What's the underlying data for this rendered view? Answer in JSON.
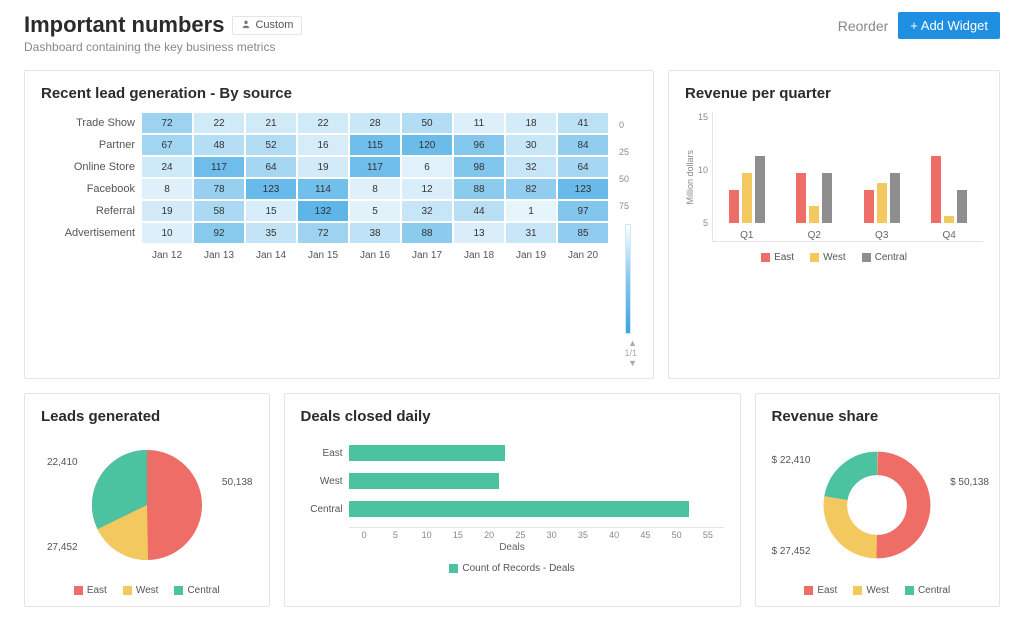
{
  "header": {
    "title": "Important numbers",
    "custom_label": "Custom",
    "subtitle": "Dashboard containing the key business metrics",
    "reorder_label": "Reorder",
    "add_widget_label": "+ Add Widget"
  },
  "heatmap": {
    "title": "Recent lead generation - By source",
    "row_labels": [
      "Trade Show",
      "Partner",
      "Online Store",
      "Facebook",
      "Referral",
      "Advertisement"
    ],
    "col_labels": [
      "Jan 12",
      "Jan 13",
      "Jan 14",
      "Jan 15",
      "Jan 16",
      "Jan 17",
      "Jan 18",
      "Jan 19",
      "Jan 20"
    ],
    "cells": [
      [
        72,
        22,
        21,
        22,
        28,
        50,
        11,
        18,
        41
      ],
      [
        67,
        48,
        52,
        16,
        115,
        120,
        96,
        30,
        84
      ],
      [
        24,
        117,
        64,
        19,
        117,
        6,
        98,
        32,
        64
      ],
      [
        8,
        78,
        123,
        114,
        8,
        12,
        88,
        82,
        123
      ],
      [
        19,
        58,
        15,
        132,
        5,
        32,
        44,
        1,
        97
      ],
      [
        10,
        92,
        35,
        72,
        38,
        88,
        13,
        31,
        85
      ]
    ],
    "scale": {
      "ticks": [
        "0",
        "25",
        "50",
        "75"
      ]
    },
    "pager": "1/1"
  },
  "revenue_quarter": {
    "title": "Revenue per quarter",
    "ylabel": "Million dollars",
    "yticks": [
      "15",
      "10",
      "5"
    ],
    "legend": [
      "East",
      "West",
      "Central"
    ]
  },
  "leads_generated": {
    "title": "Leads generated",
    "labels": {
      "east": "50,138",
      "west": "27,452",
      "teal": "22,410"
    },
    "legend": [
      "East",
      "West",
      "Central"
    ]
  },
  "deals_closed": {
    "title": "Deals closed daily",
    "row_labels": [
      "East",
      "West",
      "Central"
    ],
    "xlabel": "Deals",
    "legend_label": "Count of Records - Deals",
    "ticks": [
      "0",
      "5",
      "10",
      "15",
      "20",
      "25",
      "30",
      "35",
      "40",
      "45",
      "50",
      "55"
    ]
  },
  "revenue_share": {
    "title": "Revenue share",
    "labels": {
      "east": "$ 50,138",
      "west": "$ 27,452",
      "teal": "$ 22,410"
    },
    "legend": [
      "East",
      "West",
      "Central"
    ]
  },
  "chart_data": [
    {
      "type": "heatmap",
      "title": "Recent lead generation - By source",
      "x": [
        "Jan 12",
        "Jan 13",
        "Jan 14",
        "Jan 15",
        "Jan 16",
        "Jan 17",
        "Jan 18",
        "Jan 19",
        "Jan 20"
      ],
      "y": [
        "Trade Show",
        "Partner",
        "Online Store",
        "Facebook",
        "Referral",
        "Advertisement"
      ],
      "z": [
        [
          72,
          22,
          21,
          22,
          28,
          50,
          11,
          18,
          41
        ],
        [
          67,
          48,
          52,
          16,
          115,
          120,
          96,
          30,
          84
        ],
        [
          24,
          117,
          64,
          19,
          117,
          6,
          98,
          32,
          64
        ],
        [
          8,
          78,
          123,
          114,
          8,
          12,
          88,
          82,
          123
        ],
        [
          19,
          58,
          15,
          132,
          5,
          32,
          44,
          1,
          97
        ],
        [
          10,
          92,
          35,
          72,
          38,
          88,
          13,
          31,
          85
        ]
      ],
      "color_scale_ticks": [
        0,
        25,
        50,
        75
      ]
    },
    {
      "type": "bar",
      "title": "Revenue per quarter",
      "ylabel": "Million dollars",
      "ylim": [
        0,
        15
      ],
      "categories": [
        "Q1",
        "Q2",
        "Q3",
        "Q4"
      ],
      "series": [
        {
          "name": "East",
          "values": [
            5,
            7.5,
            5,
            10
          ]
        },
        {
          "name": "West",
          "values": [
            7.5,
            2.5,
            6,
            1
          ]
        },
        {
          "name": "Central",
          "values": [
            10,
            7.5,
            7.5,
            5
          ]
        }
      ]
    },
    {
      "type": "pie",
      "title": "Leads generated",
      "series": [
        {
          "name": "East",
          "value": 50138
        },
        {
          "name": "West",
          "value": 27452
        },
        {
          "name": "Central",
          "value": 22410
        }
      ]
    },
    {
      "type": "bar",
      "orientation": "horizontal",
      "title": "Deals closed daily",
      "xlabel": "Deals",
      "xlim": [
        0,
        55
      ],
      "categories": [
        "East",
        "West",
        "Central"
      ],
      "series": [
        {
          "name": "Count of Records - Deals",
          "values": [
            23,
            22,
            50
          ]
        }
      ]
    },
    {
      "type": "pie",
      "subtype": "donut",
      "title": "Revenue share",
      "series": [
        {
          "name": "East",
          "value": 50138
        },
        {
          "name": "West",
          "value": 27452
        },
        {
          "name": "Central",
          "value": 22410
        }
      ]
    }
  ]
}
